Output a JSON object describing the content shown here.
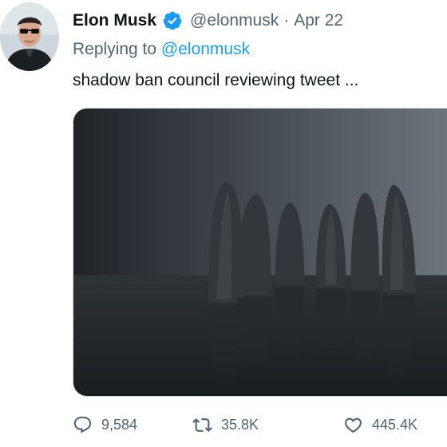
{
  "tweet": {
    "author_name": "Elon Musk",
    "verified_icon": "verified-badge-icon",
    "handle": "@elonmusk",
    "separator": "·",
    "date": "Apr 22",
    "replying_prefix": "Replying to",
    "replying_to": "@elonmusk",
    "text": "shadow ban council reviewing tweet ...",
    "media_description_icon": "hooded-figures-photo"
  },
  "actions": {
    "reply_count": "9,584",
    "retweet_count": "35.8K",
    "like_count": "445.4K"
  },
  "colors": {
    "text_primary": "#0f1419",
    "text_secondary": "#536471",
    "link": "#1d9bf0",
    "verified": "#1d9bf0"
  }
}
